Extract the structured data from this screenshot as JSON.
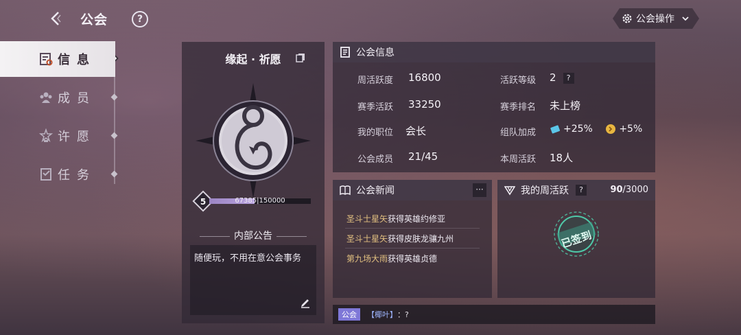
{
  "header": {
    "title": "公会",
    "help_label": "?",
    "ops_label": "公会操作"
  },
  "sidebar": {
    "items": [
      {
        "label": "信息",
        "icon": "info-card-icon",
        "active": true
      },
      {
        "label": "成员",
        "icon": "members-icon",
        "active": false
      },
      {
        "label": "许愿",
        "icon": "wish-icon",
        "active": false
      },
      {
        "label": "任务",
        "icon": "task-icon",
        "active": false
      }
    ]
  },
  "guild": {
    "name": "缘起 · 祈愿",
    "level": "5",
    "exp_current": 67385,
    "exp_max": 150000,
    "exp_text_current": "67385",
    "exp_text_max": "150000",
    "notice_title": "内部公告",
    "notice_text": "随便玩，不用在意公会事务"
  },
  "info": {
    "title": "公会信息",
    "weekly_activity_label": "周活跃度",
    "weekly_activity_value": "16800",
    "activity_level_label": "活跃等级",
    "activity_level_value": "2",
    "season_activity_label": "赛季活跃",
    "season_activity_value": "33250",
    "season_rank_label": "赛季排名",
    "season_rank_value": "未上榜",
    "my_role_label": "我的职位",
    "my_role_value": "会长",
    "team_bonus_label": "组队加成",
    "team_bonus_1": "+25%",
    "team_bonus_2": "+5%",
    "members_label": "公会成员",
    "members_value": "21/45",
    "week_active_label": "本周活跃",
    "week_active_value": "18人"
  },
  "news": {
    "title": "公会新闻",
    "more_label": "···",
    "items": [
      {
        "who": "圣斗士星矢",
        "text": "获得英雄约修亚"
      },
      {
        "who": "圣斗士星矢",
        "text": "获得皮肤龙骧九州"
      },
      {
        "who": "第九场大雨",
        "text": "获得英雄贞德"
      }
    ]
  },
  "weekly": {
    "title": "我的周活跃",
    "q_label": "?",
    "current": "90",
    "max": "/3000",
    "stamp_text": "已签到"
  },
  "chat": {
    "tag": "公会",
    "name": "【椰叶】",
    "message": "：?"
  },
  "colors": {
    "accent_gold": "#e2c080",
    "exp_purple": "#b9a3df",
    "chat_tag": "#7f78d8",
    "stamp_green": "#4fc9a8"
  }
}
